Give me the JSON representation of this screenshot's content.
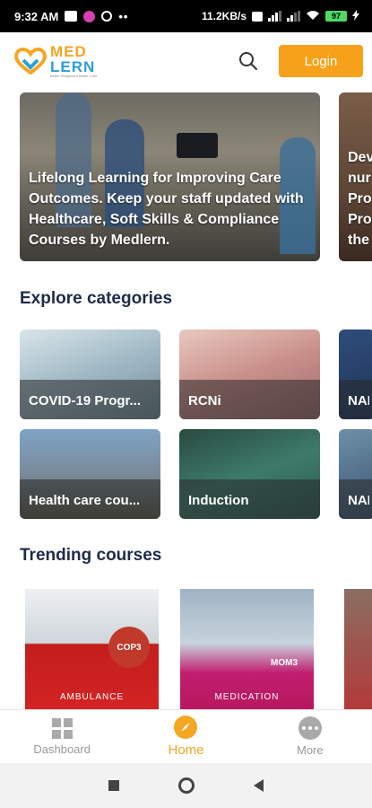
{
  "status_bar": {
    "time": "9:32 AM",
    "speed": "11.2KB/s",
    "battery": "97"
  },
  "app": {
    "logo_line1": "MED",
    "logo_line2": "LERN",
    "logo_tagline": "Better Respected Better Care",
    "login_label": "Login",
    "brand_orange": "#F7A11A",
    "brand_blue": "#2AA0D8"
  },
  "banners": [
    {
      "text": "Lifelong Learning for Improving Care Outcomes. Keep your staff updated with Healthcare, Soft Skills & Compliance Courses by Medlern."
    },
    {
      "text": "Dev nur Pro Pro the"
    }
  ],
  "explore": {
    "title": "Explore categories",
    "categories": [
      {
        "label": "COVID-19 Progr..."
      },
      {
        "label": "RCNi"
      },
      {
        "label": "NAI"
      },
      {
        "label": "Health care cou..."
      },
      {
        "label": "Induction"
      },
      {
        "label": "NAI"
      }
    ]
  },
  "trending": {
    "title": "Trending courses",
    "courses": [
      {
        "code": "COP3",
        "caption": "AMBULANCE"
      },
      {
        "code": "MOM3",
        "caption": "MEDICATION"
      },
      {
        "code": "",
        "caption": ""
      }
    ]
  },
  "bottom_nav": {
    "items": [
      {
        "label": "Dashboard",
        "icon": "dashboard-icon"
      },
      {
        "label": "Home",
        "icon": "compass-icon"
      },
      {
        "label": "More",
        "icon": "more-icon"
      }
    ]
  }
}
